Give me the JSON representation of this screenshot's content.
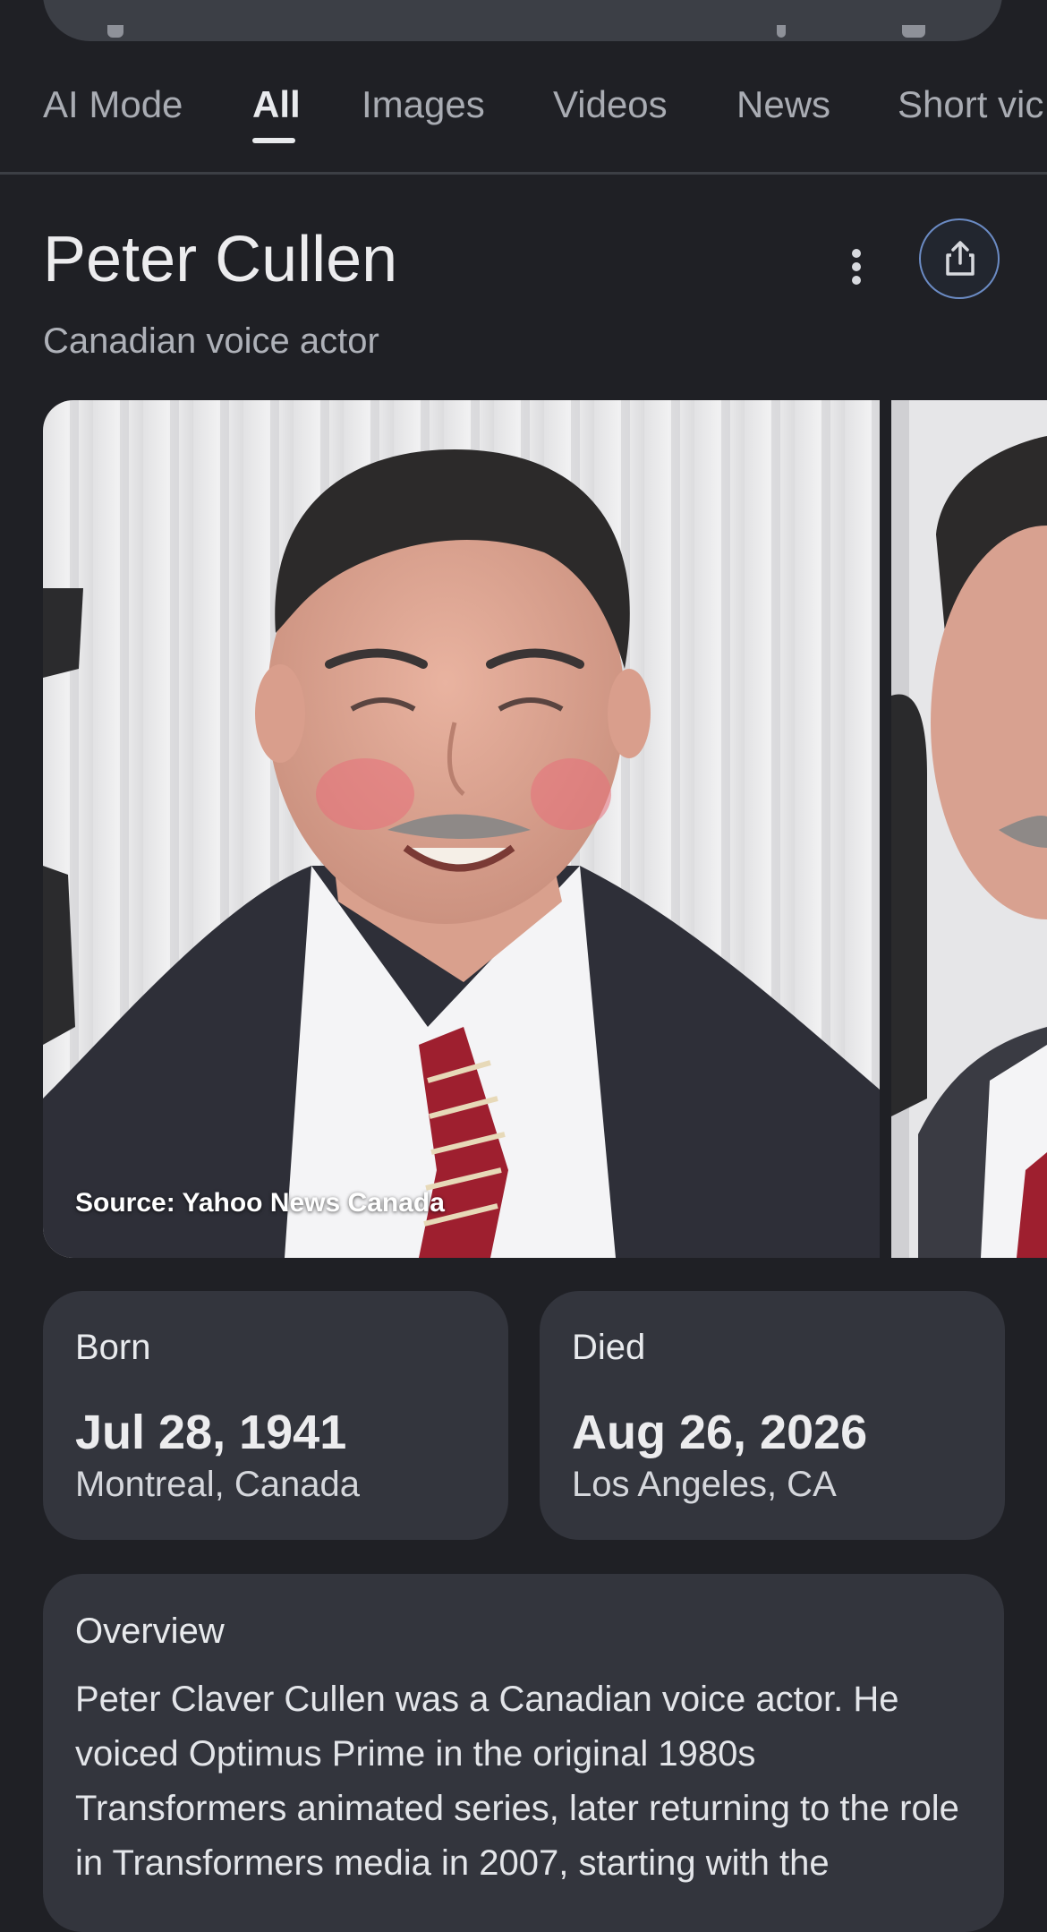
{
  "tabs": [
    {
      "label": "AI Mode",
      "active": false
    },
    {
      "label": "All",
      "active": true
    },
    {
      "label": "Images",
      "active": false
    },
    {
      "label": "Videos",
      "active": false
    },
    {
      "label": "News",
      "active": false
    },
    {
      "label": "Short vic",
      "active": false
    }
  ],
  "entity": {
    "name": "Peter Cullen",
    "description": "Canadian voice actor"
  },
  "images": {
    "source": "Source: Yahoo News Canada"
  },
  "facts": {
    "born": {
      "label": "Born",
      "date": "Jul 28, 1941",
      "place": "Montreal, Canada"
    },
    "died": {
      "label": "Died",
      "date": "Aug 26, 2026",
      "place": "Los Angeles, CA"
    }
  },
  "overview": {
    "title": "Overview",
    "text": "Peter Claver Cullen was a Canadian voice actor. He voiced Optimus Prime in the original 1980s Transformers animated series, later returning to the role in Transformers media in 2007, starting with the"
  },
  "colors": {
    "background": "#1f2025",
    "card": "#33353d",
    "accent_ring": "#6b8bc4"
  },
  "icons": [
    "search-icon",
    "more-vert-icon",
    "share-icon"
  ]
}
